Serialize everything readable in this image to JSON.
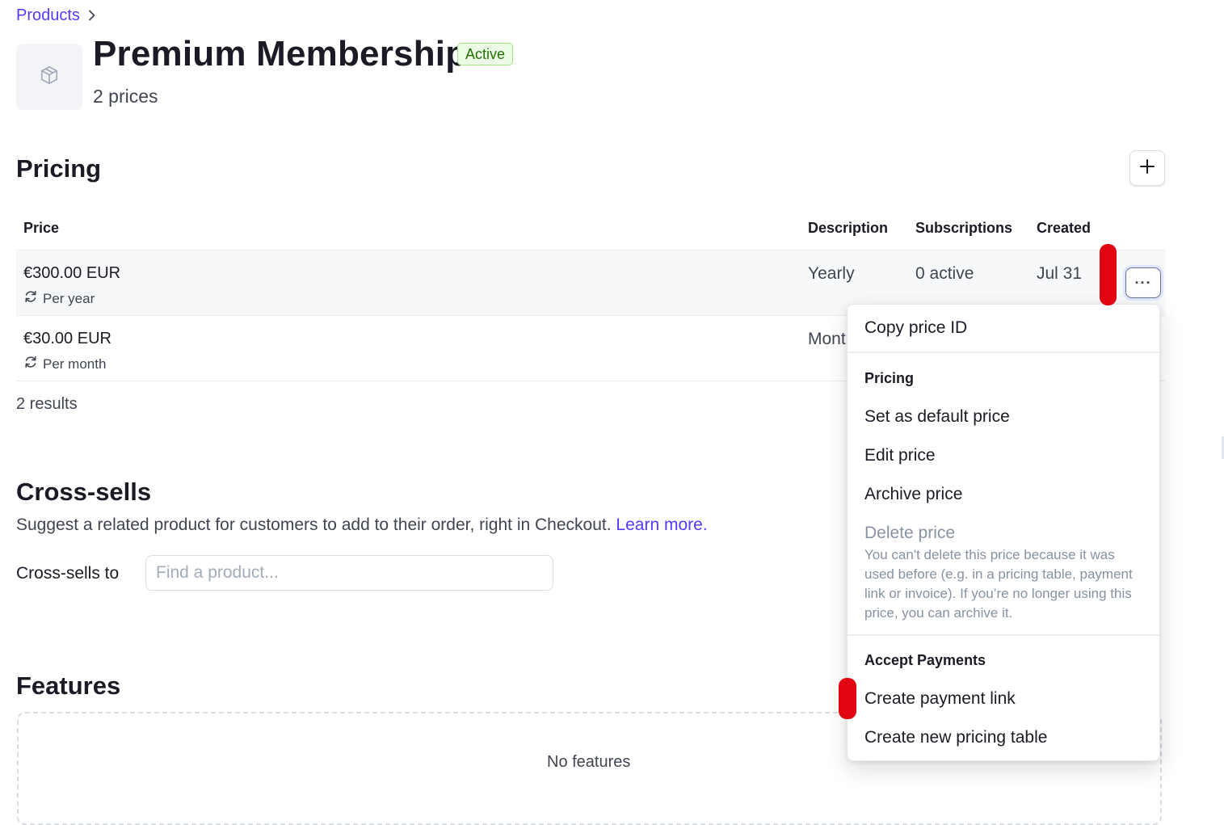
{
  "breadcrumb": {
    "parent": "Products",
    "separator": ">"
  },
  "product": {
    "title": "Premium Membership",
    "status": "Active",
    "price_count": "2 prices",
    "thumbnail_icon": "box-icon"
  },
  "pricing": {
    "title": "Pricing",
    "add_button_label": "+",
    "columns": {
      "price": "Price",
      "description": "Description",
      "subscriptions": "Subscriptions",
      "created": "Created"
    },
    "rows": [
      {
        "amount": "€300.00 EUR",
        "interval": "Per year",
        "description": "Yearly",
        "subscriptions": "0 active",
        "created": "Jul 31"
      },
      {
        "amount": "€30.00 EUR",
        "interval": "Per month",
        "description": "Mont"
      }
    ],
    "results": "2 results",
    "row_menu_label": "···"
  },
  "crosssells": {
    "title": "Cross-sells",
    "description": "Suggest a related product for customers to add to their order, right in Checkout.",
    "learn_more": "Learn more",
    "period": ".",
    "label": "Cross-sells to",
    "placeholder": "Find a product..."
  },
  "features": {
    "title": "Features",
    "empty": "No features"
  },
  "menu": {
    "copy_id": "Copy price ID",
    "pricing_heading": "Pricing",
    "set_default": "Set as default price",
    "edit": "Edit price",
    "archive": "Archive price",
    "delete": "Delete price",
    "delete_note": "You can't delete this price because it was used before (e.g. in a pricing table, payment link or invoice). If you’re no longer using this price, you can archive it.",
    "payments_heading": "Accept Payments",
    "create_link": "Create payment link",
    "create_table": "Create new pricing table"
  },
  "colors": {
    "accent": "#533afd",
    "badge_bg": "#ecfbe5",
    "badge_text": "#217005",
    "annotation": "#e1060f"
  }
}
